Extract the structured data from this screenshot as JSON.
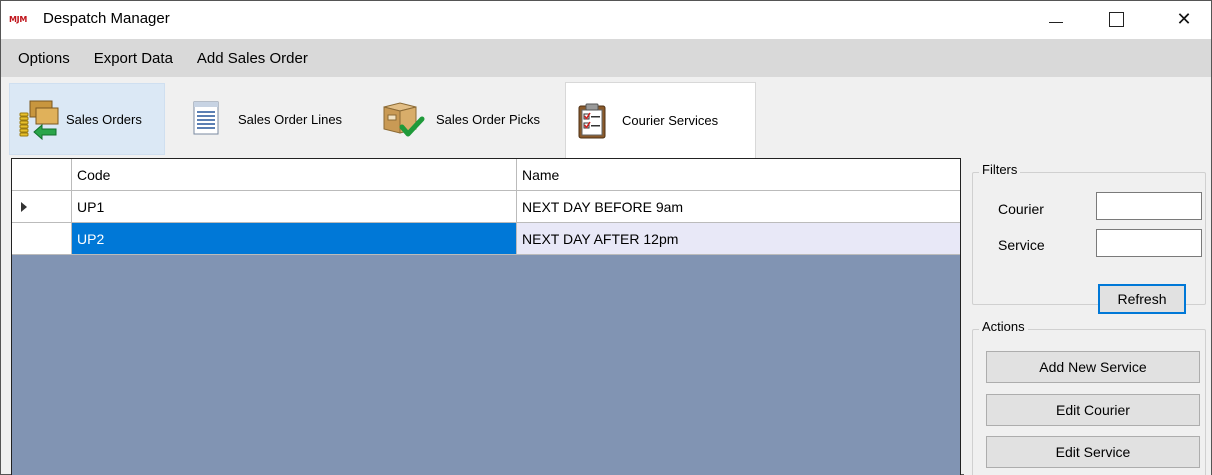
{
  "window": {
    "logo_text": "MJM",
    "title": "Despatch Manager",
    "minimize_label": "Minimize",
    "maximize_label": "Maximize",
    "close_glyph": "✕"
  },
  "menu": {
    "items": [
      "Options",
      "Export Data",
      "Add Sales Order"
    ]
  },
  "tabs": [
    {
      "label": "Sales Orders",
      "icon": "boxes-coins-icon",
      "state": "hover"
    },
    {
      "label": "Sales Order Lines",
      "icon": "document-lines-icon",
      "state": "normal"
    },
    {
      "label": "Sales Order Picks",
      "icon": "box-check-icon",
      "state": "normal"
    },
    {
      "label": "Courier Services",
      "icon": "clipboard-checklist-icon",
      "state": "active"
    }
  ],
  "grid": {
    "columns": [
      "Code",
      "Name"
    ],
    "rows": [
      {
        "code": "UP1",
        "name": "NEXT DAY BEFORE 9am",
        "current": true
      },
      {
        "code": "UP2",
        "name": "NEXT DAY AFTER 12pm",
        "selected": true
      }
    ]
  },
  "filters": {
    "title": "Filters",
    "courier_label": "Courier",
    "courier_value": "",
    "service_label": "Service",
    "service_value": "",
    "refresh_label": "Refresh"
  },
  "actions": {
    "title": "Actions",
    "buttons": [
      "Add New Service",
      "Edit Courier",
      "Edit Service"
    ]
  },
  "colors": {
    "selection": "#0078d7",
    "grid_background": "#8194b3",
    "menu_background": "#d9d9d9"
  }
}
